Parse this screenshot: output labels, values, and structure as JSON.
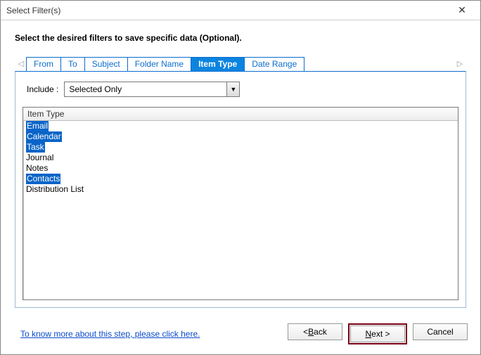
{
  "window": {
    "title": "Select Filter(s)"
  },
  "instruction": "Select the desired filters to save specific data (Optional).",
  "tabs": [
    {
      "label": "From",
      "active": false
    },
    {
      "label": "To",
      "active": false
    },
    {
      "label": "Subject",
      "active": false
    },
    {
      "label": "Folder Name",
      "active": false
    },
    {
      "label": "Item Type",
      "active": true
    },
    {
      "label": "Date Range",
      "active": false
    }
  ],
  "include": {
    "label": "Include :",
    "value": "Selected Only"
  },
  "list": {
    "header": "Item Type",
    "items": [
      {
        "text": "Email",
        "selected": true
      },
      {
        "text": "Calendar",
        "selected": true
      },
      {
        "text": "Task",
        "selected": true
      },
      {
        "text": "Journal",
        "selected": false
      },
      {
        "text": "Notes",
        "selected": false
      },
      {
        "text": "Contacts",
        "selected": true
      },
      {
        "text": "Distribution List",
        "selected": false
      }
    ]
  },
  "help_link": "To know more about this step, please click here.",
  "buttons": {
    "back_prefix": "< ",
    "back_u": "B",
    "back_rest": "ack",
    "next_u": "N",
    "next_rest": "ext >",
    "cancel": "Cancel"
  }
}
